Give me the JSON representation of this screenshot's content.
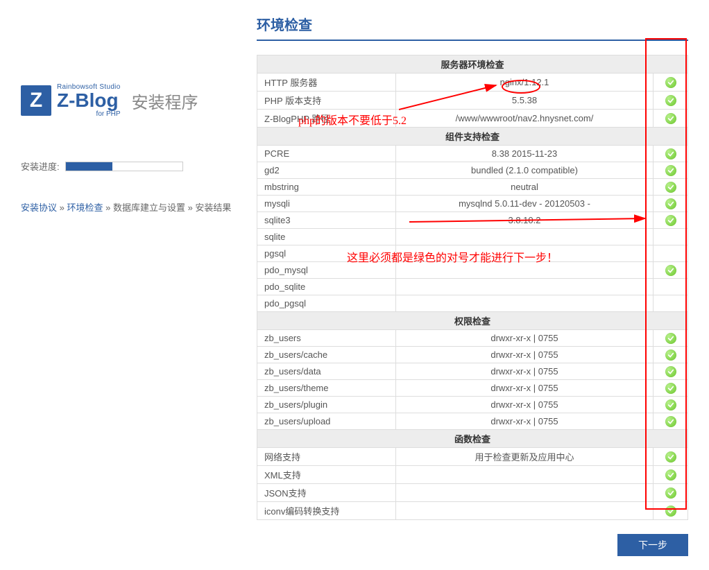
{
  "logo": {
    "letter": "Z",
    "small": "Rainbowsoft Studio",
    "main": "Z-Blog",
    "sub": "for PHP",
    "install": "安装程序"
  },
  "progress": {
    "label": "安装进度:"
  },
  "breadcrumb": {
    "step1": "安装协议",
    "step2": "环境检查",
    "sep": " » ",
    "rest": "数据库建立与设置 » 安装结果"
  },
  "page_title": "环境检查",
  "sections": [
    {
      "header": "服务器环境检查",
      "rows": [
        {
          "label": "HTTP 服务器",
          "value": "nginx/1.12.1",
          "ok": true
        },
        {
          "label": "PHP 版本支持",
          "value": "5.5.38",
          "ok": true
        },
        {
          "label": "Z-BlogPHP 路径",
          "value": "/www/wwwroot/nav2.hnysnet.com/",
          "ok": true
        }
      ]
    },
    {
      "header": "组件支持检查",
      "rows": [
        {
          "label": "PCRE",
          "value": "8.38 2015-11-23",
          "ok": true
        },
        {
          "label": "gd2",
          "value": "bundled (2.1.0 compatible)",
          "ok": true
        },
        {
          "label": "mbstring",
          "value": "neutral",
          "ok": true
        },
        {
          "label": "mysqli",
          "value": "mysqlnd 5.0.11-dev - 20120503 -",
          "ok": true
        },
        {
          "label": "sqlite3",
          "value": "3.8.10.2",
          "ok": true
        },
        {
          "label": "sqlite",
          "value": "",
          "ok": false
        },
        {
          "label": "pgsql",
          "value": "",
          "ok": false
        },
        {
          "label": "pdo_mysql",
          "value": "",
          "ok": true
        },
        {
          "label": "pdo_sqlite",
          "value": "",
          "ok": false
        },
        {
          "label": "pdo_pgsql",
          "value": "",
          "ok": false
        }
      ]
    },
    {
      "header": "权限检查",
      "rows": [
        {
          "label": "zb_users",
          "value": "drwxr-xr-x | 0755",
          "ok": true
        },
        {
          "label": "zb_users/cache",
          "value": "drwxr-xr-x | 0755",
          "ok": true
        },
        {
          "label": "zb_users/data",
          "value": "drwxr-xr-x | 0755",
          "ok": true
        },
        {
          "label": "zb_users/theme",
          "value": "drwxr-xr-x | 0755",
          "ok": true
        },
        {
          "label": "zb_users/plugin",
          "value": "drwxr-xr-x | 0755",
          "ok": true
        },
        {
          "label": "zb_users/upload",
          "value": "drwxr-xr-x | 0755",
          "ok": true
        }
      ]
    },
    {
      "header": "函数检查",
      "rows": [
        {
          "label": "网络支持",
          "value": "用于检查更新及应用中心",
          "ok": true
        },
        {
          "label": "XML支持",
          "value": "",
          "ok": true
        },
        {
          "label": "JSON支持",
          "value": "",
          "ok": true
        },
        {
          "label": "iconv编码转换支持",
          "value": "",
          "ok": true
        }
      ]
    }
  ],
  "next_button": "下一步",
  "annotations": {
    "ann1": "php的版本不要低于5.2",
    "ann2": "这里必须都是绿色的对号才能进行下一步！"
  }
}
